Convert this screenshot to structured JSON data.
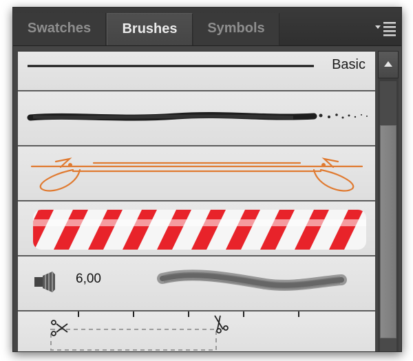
{
  "tabs": [
    {
      "label": "Swatches",
      "active": false
    },
    {
      "label": "Brushes",
      "active": true
    },
    {
      "label": "Symbols",
      "active": false
    }
  ],
  "panel_menu_icon": "panel-menu-icon",
  "brushes": [
    {
      "type": "calligraphic",
      "label": "Basic"
    },
    {
      "type": "art-charcoal"
    },
    {
      "type": "art-arrow-orange"
    },
    {
      "type": "pattern-red-stripes"
    },
    {
      "type": "bristle",
      "icon": "bristle-brush-icon",
      "value": "6,00"
    },
    {
      "type": "pattern-scissors-cut-line"
    }
  ],
  "colors": {
    "panel_bg": "#454545",
    "tab_active_text": "#ececec",
    "tab_inactive_text": "#8e8e8e",
    "list_bg": "#e2e2e2",
    "arrow_orange": "#e07a30",
    "stripe_red": "#e8232a"
  }
}
